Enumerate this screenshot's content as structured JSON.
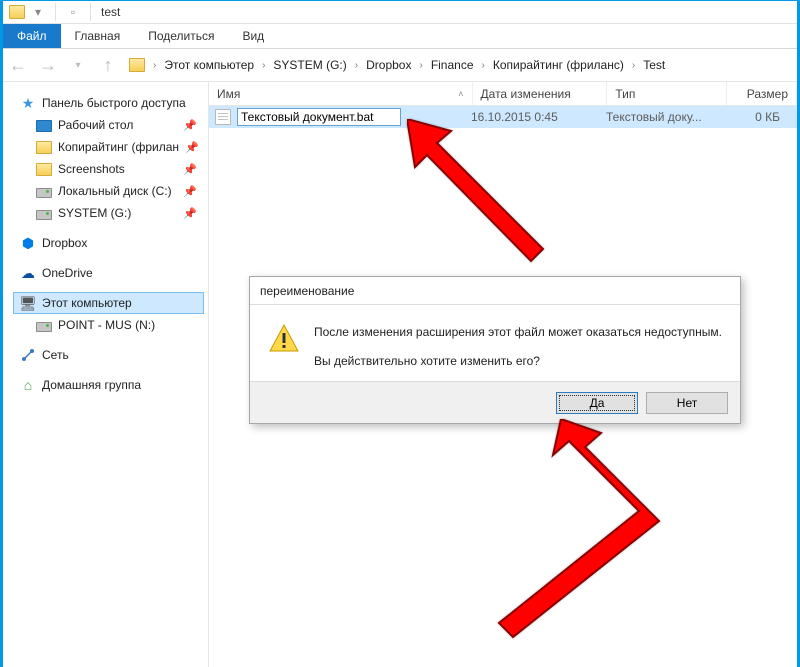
{
  "titlebar": {
    "title": "test"
  },
  "ribbon": {
    "file": "Файл",
    "home": "Главная",
    "share": "Поделиться",
    "view": "Вид"
  },
  "addressbar": {
    "segments": [
      "Этот компьютер",
      "SYSTEM (G:)",
      "Dropbox",
      "Finance",
      "Копирайтинг (фриланс)",
      "Test"
    ]
  },
  "sidebar": {
    "quick_access": "Панель быстрого доступа",
    "items": [
      {
        "label": "Рабочий стол",
        "icon": "desktop",
        "pinned": true
      },
      {
        "label": "Копирайтинг (фрилан",
        "icon": "folder",
        "pinned": true
      },
      {
        "label": "Screenshots",
        "icon": "folder",
        "pinned": true
      },
      {
        "label": "Локальный диск (C:)",
        "icon": "drive",
        "pinned": true
      },
      {
        "label": "SYSTEM (G:)",
        "icon": "drive",
        "pinned": true
      }
    ],
    "dropbox": "Dropbox",
    "onedrive": "OneDrive",
    "this_pc": "Этот компьютер",
    "point_mus": "POINT - MUS (N:)",
    "network": "Сеть",
    "homegroup": "Домашняя группа"
  },
  "columns": {
    "name": "Имя",
    "date": "Дата изменения",
    "type": "Тип",
    "size": "Размер"
  },
  "file": {
    "name_value": "Текстовый документ.bat",
    "date": "16.10.2015 0:45",
    "type": "Текстовый доку...",
    "size": "0 КБ"
  },
  "dialog": {
    "title": "переименование",
    "line1": "После изменения расширения этот файл может оказаться недоступным.",
    "line2": "Вы действительно хотите изменить его?",
    "yes": "Да",
    "no": "Нет"
  }
}
